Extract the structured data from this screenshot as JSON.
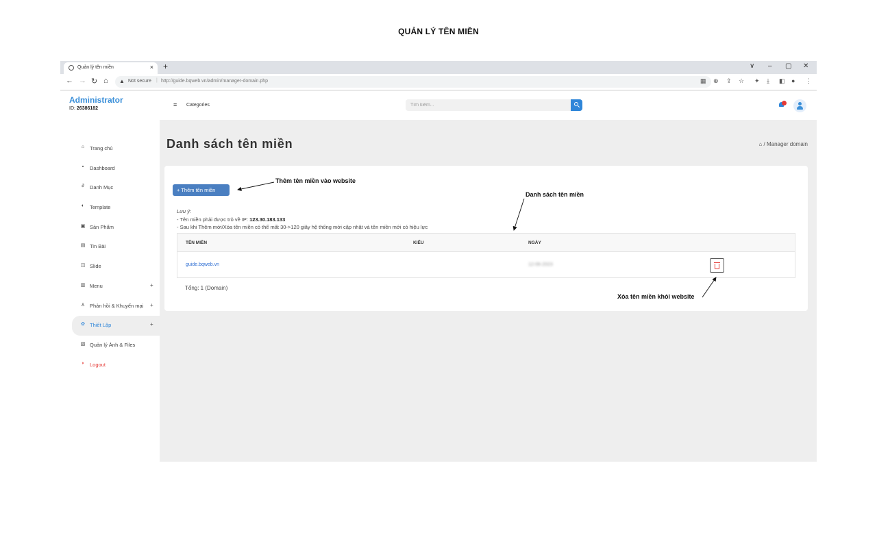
{
  "doc_title": "QUẢN LÝ TÊN MIỀN",
  "browser": {
    "tab_title": "Quản lý tên miền",
    "tab_close": "×",
    "new_tab": "+",
    "security_label": "Not secure",
    "url": "http://guide.bqweb.vn/admin/manager-domain.php",
    "window_controls": [
      "∨",
      "–",
      "▢",
      "✕"
    ]
  },
  "sidebar": {
    "brand": "Administrator",
    "id_label": "ID:",
    "id_value": "26386182",
    "items": [
      {
        "icon": "home-icon",
        "glyph": "⌂",
        "label": "Trang chủ",
        "plus": ""
      },
      {
        "icon": "dashboard-icon",
        "glyph": "▪",
        "label": "Dashboard",
        "plus": ""
      },
      {
        "icon": "link-icon",
        "glyph": "∂",
        "label": "Danh Mục",
        "plus": ""
      },
      {
        "icon": "template-icon",
        "glyph": "◐",
        "label": "Template",
        "plus": ""
      },
      {
        "icon": "product-icon",
        "glyph": "▣",
        "label": "Sản Phẩm",
        "plus": ""
      },
      {
        "icon": "news-icon",
        "glyph": "▤",
        "label": "Tin Bài",
        "plus": ""
      },
      {
        "icon": "slide-icon",
        "glyph": "◫",
        "label": "Slide",
        "plus": ""
      },
      {
        "icon": "menu-icon",
        "glyph": "▥",
        "label": "Menu",
        "plus": "+"
      },
      {
        "icon": "feedback-icon",
        "glyph": "♙",
        "label": "Phản hồi & Khuyến mại",
        "plus": "+"
      },
      {
        "icon": "settings-icon",
        "glyph": "✿",
        "label": "Thiết Lập",
        "plus": "+"
      },
      {
        "icon": "files-icon",
        "glyph": "▧",
        "label": "Quản lý Ảnh & Files",
        "plus": ""
      },
      {
        "icon": "logout-icon",
        "glyph": "◗",
        "label": "Logout",
        "plus": ""
      }
    ]
  },
  "topbar": {
    "categories_label": "Categories",
    "search_placeholder": "Tìm kiếm..."
  },
  "main": {
    "heading": "Danh sách tên miền",
    "breadcrumb": "Manager domain",
    "add_button": "+ Thêm tên miền",
    "note_title": "Lưu ý:",
    "note_line1": "- Tên miền phải được trỏ về IP:",
    "note_ip": "123.30.183.133",
    "note_line2": "- Sau khi Thêm mới/Xóa tên miền có thể mất 30->120 giây hệ thống mới cập nhật và tên miền mới có hiệu lực",
    "columns": [
      "TÊN MIỀN",
      "KIỂU",
      "NGÀY"
    ],
    "rows": [
      {
        "domain": "guide.bqweb.vn",
        "type": "",
        "date": "12-06-2023"
      }
    ],
    "total": "Tổng: 1 (Domain)"
  },
  "annotations": {
    "add": "Thêm tên miền vào website",
    "list": "Danh sách tên miền",
    "delete": "Xóa tên miền khỏi website"
  }
}
